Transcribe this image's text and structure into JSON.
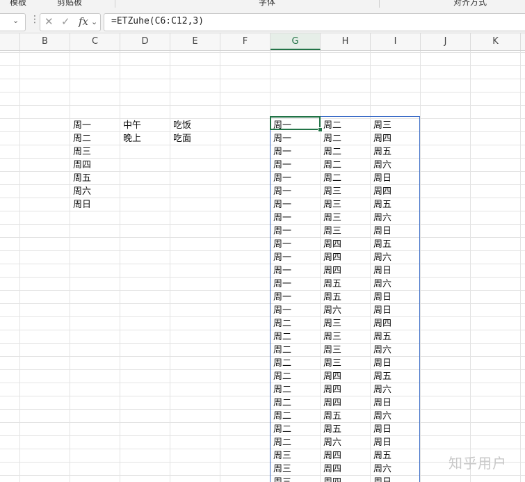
{
  "ribbon": {
    "items": [
      "模板",
      "剪贴板",
      "字体",
      "对齐方式"
    ]
  },
  "formula_bar": {
    "fx_label": "fx",
    "cancel_symbol": "✕",
    "confirm_symbol": "✓",
    "formula": "=ETZuhe(C6:C12,3)"
  },
  "columns": [
    "B",
    "C",
    "D",
    "E",
    "F",
    "G",
    "H",
    "I",
    "J",
    "K"
  ],
  "selected_column": "G",
  "source": {
    "C": [
      "周一",
      "周二",
      "周三",
      "周四",
      "周五",
      "周六",
      "周日"
    ],
    "D": [
      "中午",
      "晚上"
    ],
    "E": [
      "吃饭",
      "吃面"
    ]
  },
  "result_rows": [
    [
      "周一",
      "周二",
      "周三"
    ],
    [
      "周一",
      "周二",
      "周四"
    ],
    [
      "周一",
      "周二",
      "周五"
    ],
    [
      "周一",
      "周二",
      "周六"
    ],
    [
      "周一",
      "周二",
      "周日"
    ],
    [
      "周一",
      "周三",
      "周四"
    ],
    [
      "周一",
      "周三",
      "周五"
    ],
    [
      "周一",
      "周三",
      "周六"
    ],
    [
      "周一",
      "周三",
      "周日"
    ],
    [
      "周一",
      "周四",
      "周五"
    ],
    [
      "周一",
      "周四",
      "周六"
    ],
    [
      "周一",
      "周四",
      "周日"
    ],
    [
      "周一",
      "周五",
      "周六"
    ],
    [
      "周一",
      "周五",
      "周日"
    ],
    [
      "周一",
      "周六",
      "周日"
    ],
    [
      "周二",
      "周三",
      "周四"
    ],
    [
      "周二",
      "周三",
      "周五"
    ],
    [
      "周二",
      "周三",
      "周六"
    ],
    [
      "周二",
      "周三",
      "周日"
    ],
    [
      "周二",
      "周四",
      "周五"
    ],
    [
      "周二",
      "周四",
      "周六"
    ],
    [
      "周二",
      "周四",
      "周日"
    ],
    [
      "周二",
      "周五",
      "周六"
    ],
    [
      "周二",
      "周五",
      "周日"
    ],
    [
      "周二",
      "周六",
      "周日"
    ],
    [
      "周三",
      "周四",
      "周五"
    ],
    [
      "周三",
      "周四",
      "周六"
    ],
    [
      "周三",
      "周四",
      "周日"
    ]
  ],
  "watermark": "知乎用户"
}
